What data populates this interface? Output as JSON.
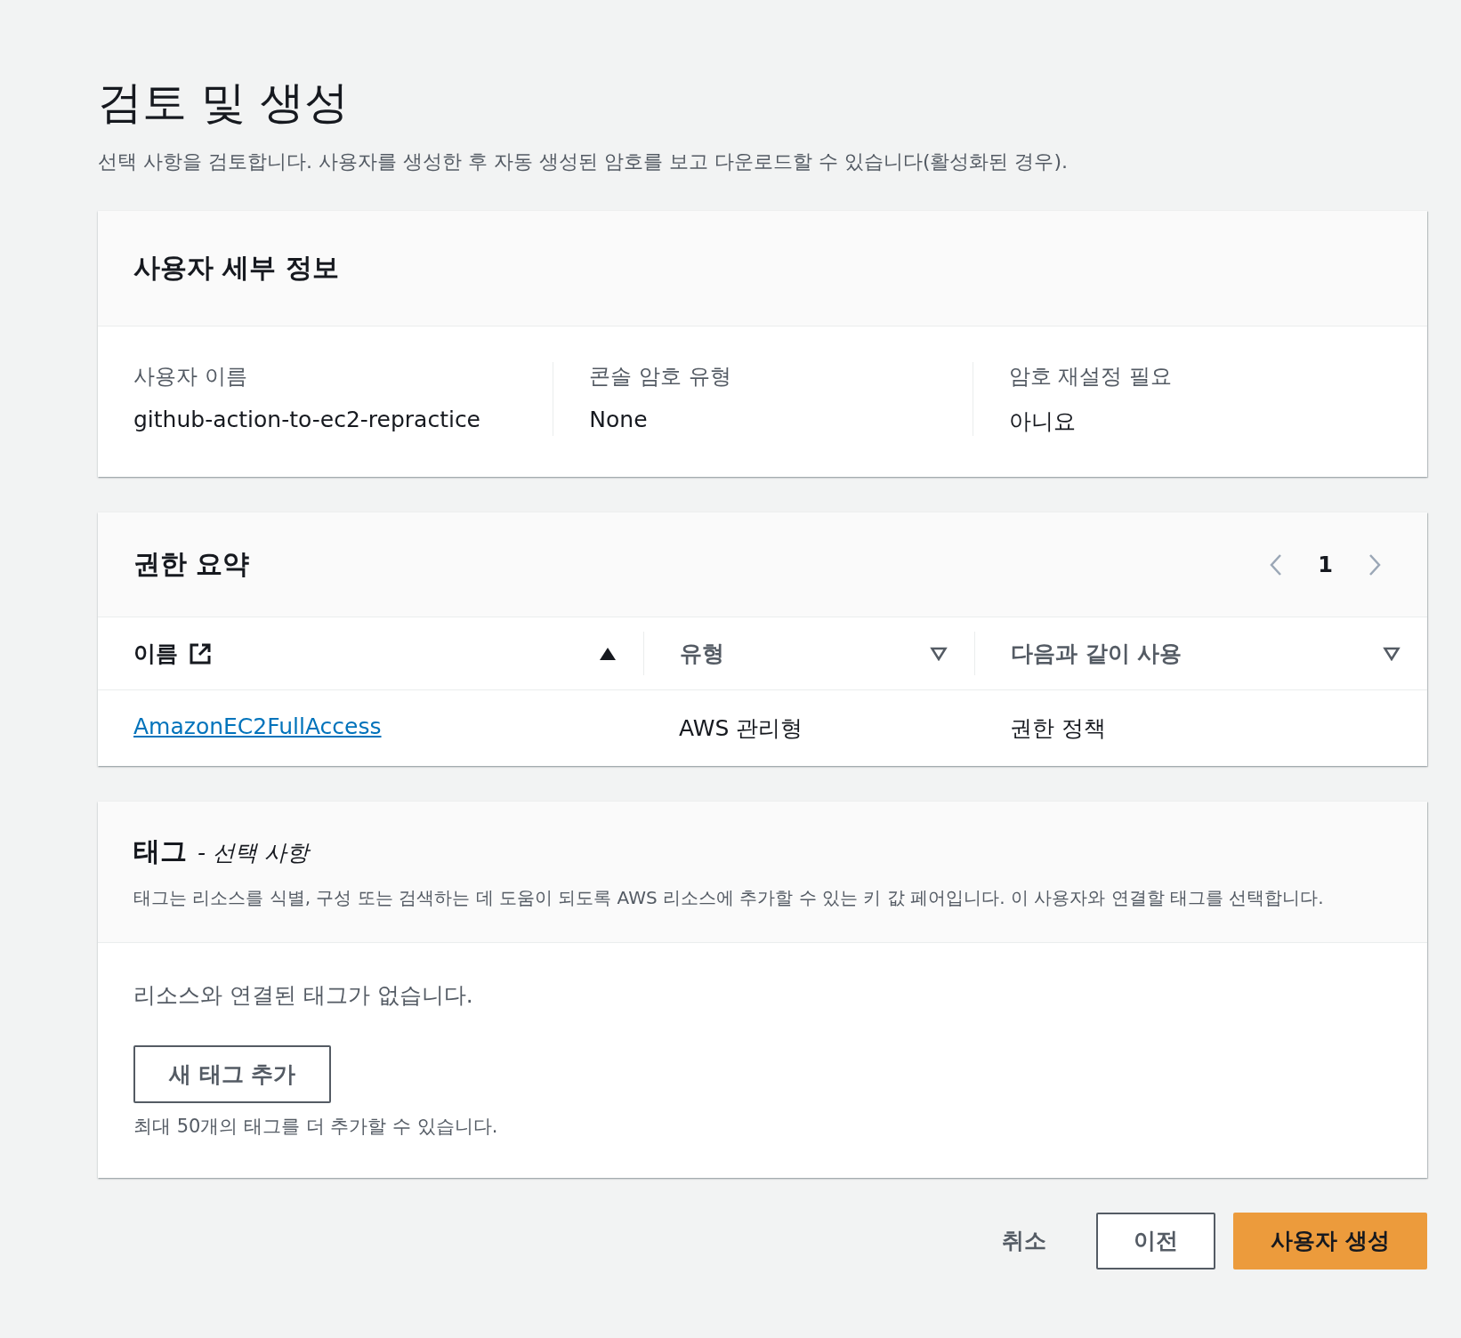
{
  "page": {
    "title": "검토 및 생성",
    "description": "선택 사항을 검토합니다. 사용자를 생성한 후 자동 생성된 암호를 보고 다운로드할 수 있습니다(활성화된 경우)."
  },
  "user_details": {
    "title": "사용자 세부 정보",
    "fields": [
      {
        "label": "사용자 이름",
        "value": "github-action-to-ec2-repractice"
      },
      {
        "label": "콘솔 암호 유형",
        "value": "None"
      },
      {
        "label": "암호 재설정 필요",
        "value": "아니요"
      }
    ]
  },
  "permissions": {
    "title": "권한 요약",
    "pagination": {
      "page": "1"
    },
    "table": {
      "columns": [
        {
          "label": "이름",
          "external_link": true,
          "sorted": true
        },
        {
          "label": "유형",
          "external_link": false,
          "sorted": false
        },
        {
          "label": "다음과 같이 사용",
          "external_link": false,
          "sorted": false
        }
      ],
      "rows": [
        {
          "cells": [
            "AmazonEC2FullAccess",
            "AWS 관리형",
            "권한 정책"
          ]
        }
      ]
    }
  },
  "tags": {
    "title": "태그",
    "subtitle": "- 선택 사항",
    "description": "태그는 리소스를 식별, 구성 또는 검색하는 데 도움이 되도록 AWS 리소스에 추가할 수 있는 키 값 페어입니다. 이 사용자와 연결할 태그를 선택합니다.",
    "empty_message": "리소스와 연결된 태그가 없습니다.",
    "add_button": "새 태그 추가",
    "hint": "최대 50개의 태그를 더 추가할 수 있습니다."
  },
  "actions": [
    {
      "label": "취소",
      "kind": "link"
    },
    {
      "label": "이전",
      "kind": "normal"
    },
    {
      "label": "사용자 생성",
      "kind": "primary"
    }
  ]
}
